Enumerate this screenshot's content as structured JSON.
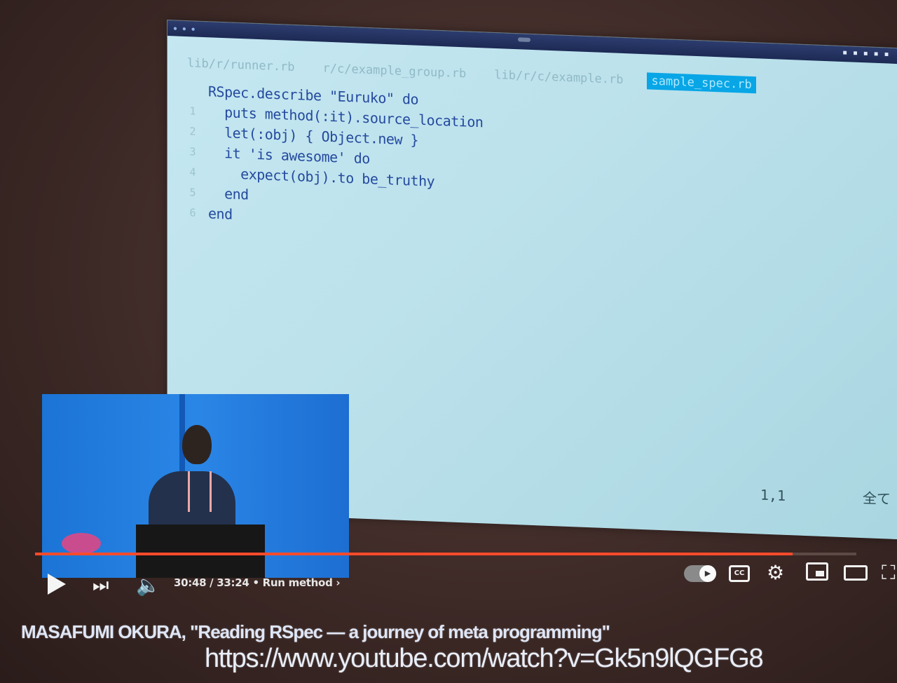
{
  "editor": {
    "tabs": [
      {
        "label": "lib/r/runner.rb",
        "active": false
      },
      {
        "label": "r/c/example_group.rb",
        "active": false
      },
      {
        "label": "lib/r/c/example.rb",
        "active": false
      },
      {
        "label": "sample_spec.rb",
        "active": true
      }
    ],
    "lines": [
      {
        "num": "",
        "code": "RSpec.describe \"Euruko\" do"
      },
      {
        "num": "1",
        "code": "  puts method(:it).source_location"
      },
      {
        "num": "2",
        "code": "  let(:obj) { Object.new }"
      },
      {
        "num": "3",
        "code": "  it 'is awesome' do"
      },
      {
        "num": "4",
        "code": "    expect(obj).to be_truthy"
      },
      {
        "num": "5",
        "code": "  end"
      },
      {
        "num": "6",
        "code": "end"
      }
    ],
    "cursor_position": "1,1",
    "scroll_position": "全て"
  },
  "player": {
    "time": "30:48 / 33:24",
    "chapter": "• Run method ›",
    "progress": 0.922,
    "autoplay_on": true,
    "cc_label": "CC",
    "colors": {
      "progress": "#ff4b2b",
      "tab_active": "#08a6e6"
    }
  },
  "caption": {
    "title": "MASAFUMI OKURA, \"Reading RSpec — a journey of meta programming\"",
    "url": "https://www.youtube.com/watch?v=Gk5n9lQGFG8"
  }
}
